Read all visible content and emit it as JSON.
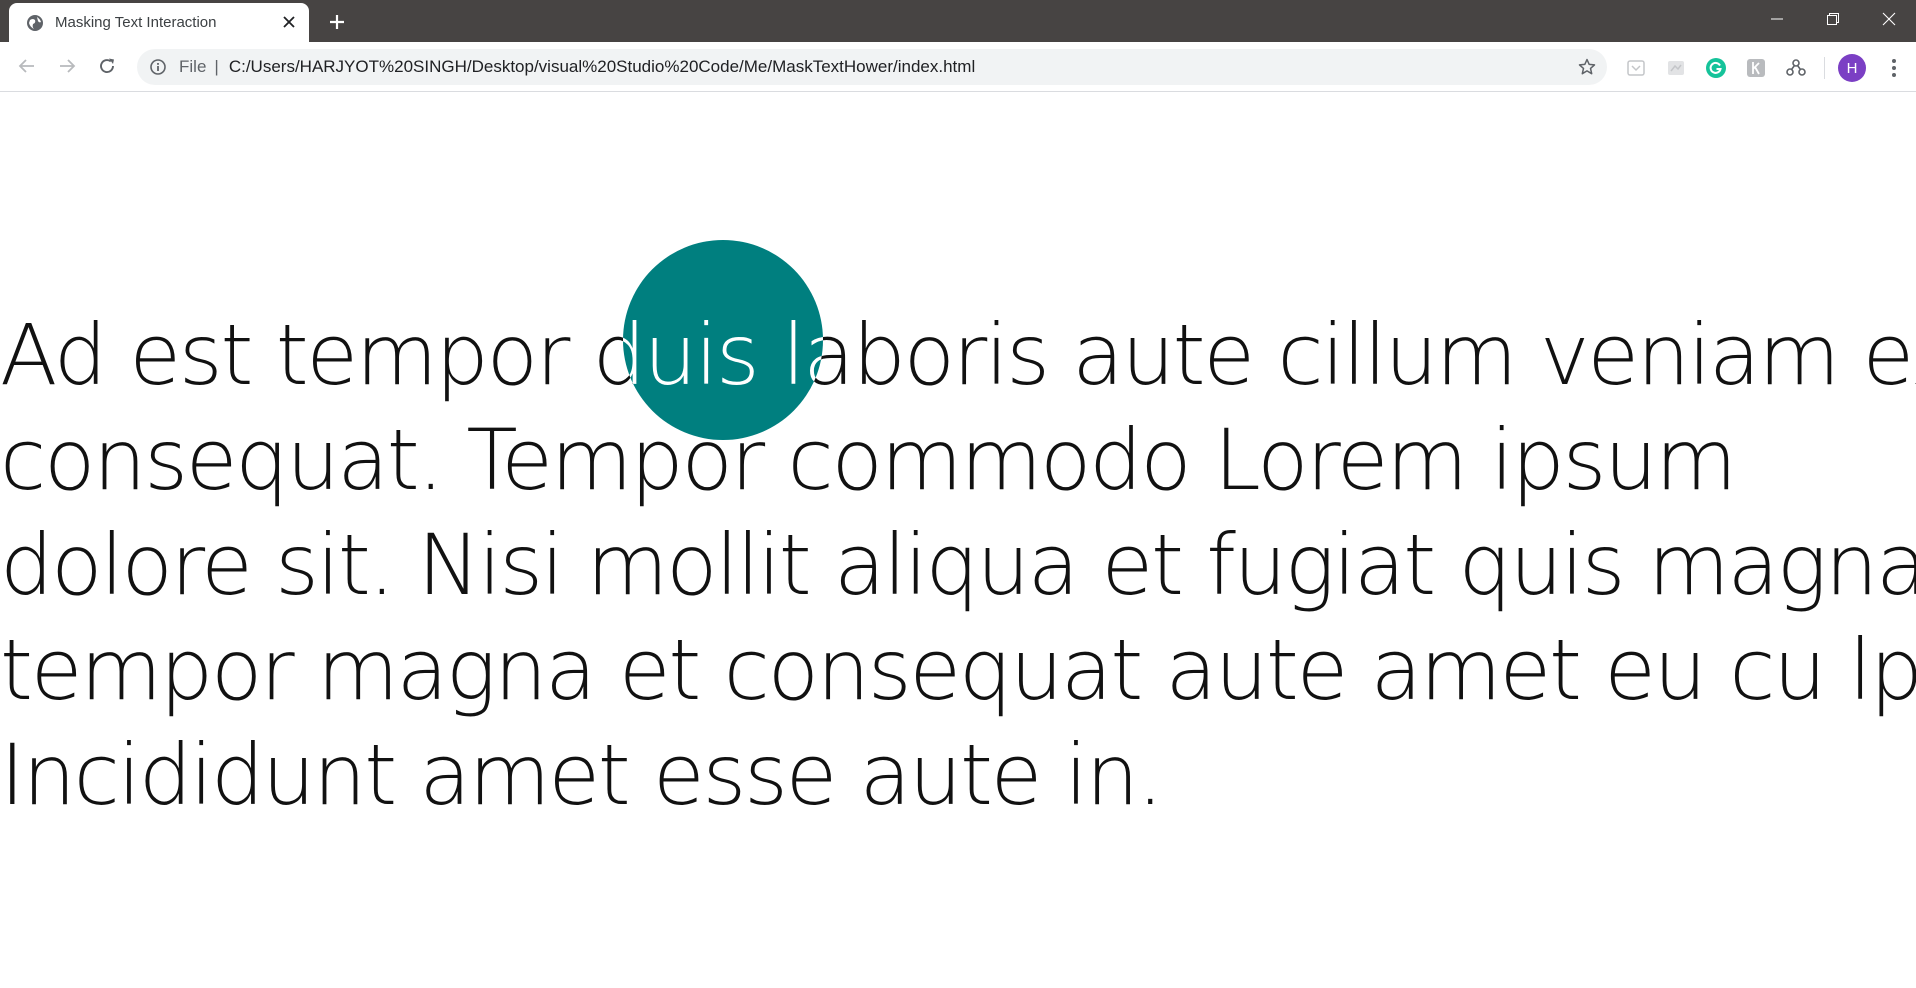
{
  "browser": {
    "tab": {
      "title": "Masking Text Interaction",
      "favicon_icon": "globe-icon"
    },
    "window_controls": [
      "minimize-icon",
      "restore-icon",
      "close-icon"
    ],
    "toolbar": {
      "scheme_label": "File",
      "separator": "|",
      "url": "C:/Users/HARJYOT%20SINGH/Desktop/visual%20Studio%20Code/Me/MaskTextHower/index.html"
    },
    "extensions": [
      "pocket-icon",
      "snip-icon",
      "grammarly-icon",
      "k-extension-icon",
      "network-icon"
    ],
    "profile": {
      "initial": "H",
      "color": "#7b3fc4"
    }
  },
  "page": {
    "lines": [
      "Ad est tempor duis laboris aute cillum veniam ex",
      "consequat. Tempor commodo Lorem ipsum",
      "dolore sit. Nisi mollit aliqua et fugiat quis magna",
      "tempor magna et consequat aute amet eu cu lpa.",
      "Incididunt amet esse aute in."
    ],
    "mask_color": "#007f7f",
    "text_color": "#111111"
  }
}
